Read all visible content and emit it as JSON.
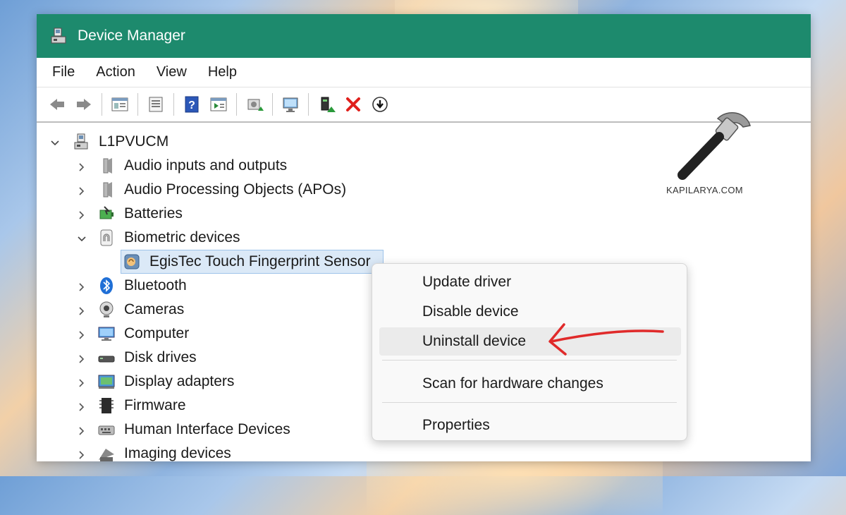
{
  "window": {
    "title": "Device Manager"
  },
  "menu": [
    "File",
    "Action",
    "View",
    "Help"
  ],
  "toolbar": {
    "buttons": [
      "back-icon",
      "forward-icon",
      "show-hide-tree-icon",
      "properties-icon",
      "help-icon",
      "view-icon",
      "update-driver-icon",
      "scan-hardware-icon",
      "enable-device-icon",
      "uninstall-icon",
      "download-icon"
    ]
  },
  "tree": {
    "root": "L1PVUCM",
    "items": [
      {
        "label": "Audio inputs and outputs",
        "icon": "speaker-icon"
      },
      {
        "label": "Audio Processing Objects (APOs)",
        "icon": "speaker-icon"
      },
      {
        "label": "Batteries",
        "icon": "battery-icon"
      },
      {
        "label": "Biometric devices",
        "icon": "fingerprint-icon",
        "expanded": true
      },
      {
        "label": "EgisTec Touch Fingerprint Sensor",
        "icon": "sensor-icon",
        "child": true,
        "selected": true
      },
      {
        "label": "Bluetooth",
        "icon": "bluetooth-icon"
      },
      {
        "label": "Cameras",
        "icon": "camera-icon"
      },
      {
        "label": "Computer",
        "icon": "monitor-icon"
      },
      {
        "label": "Disk drives",
        "icon": "disk-icon"
      },
      {
        "label": "Display adapters",
        "icon": "display-adapter-icon"
      },
      {
        "label": "Firmware",
        "icon": "firmware-icon"
      },
      {
        "label": "Human Interface Devices",
        "icon": "hid-icon"
      },
      {
        "label": "Imaging devices",
        "icon": "imaging-icon"
      }
    ]
  },
  "context_menu": {
    "items": [
      {
        "label": "Update driver",
        "hover": false
      },
      {
        "label": "Disable device",
        "hover": false
      },
      {
        "label": "Uninstall device",
        "hover": true
      },
      {
        "label": "Scan for hardware changes",
        "hover": false
      },
      {
        "label": "Properties",
        "hover": false
      }
    ]
  },
  "watermark": {
    "text": "KAPILARYA.COM"
  },
  "colors": {
    "titlebar": "#1d8a6d",
    "arrow": "#e02a2a",
    "selection": "#dbe9f7"
  }
}
